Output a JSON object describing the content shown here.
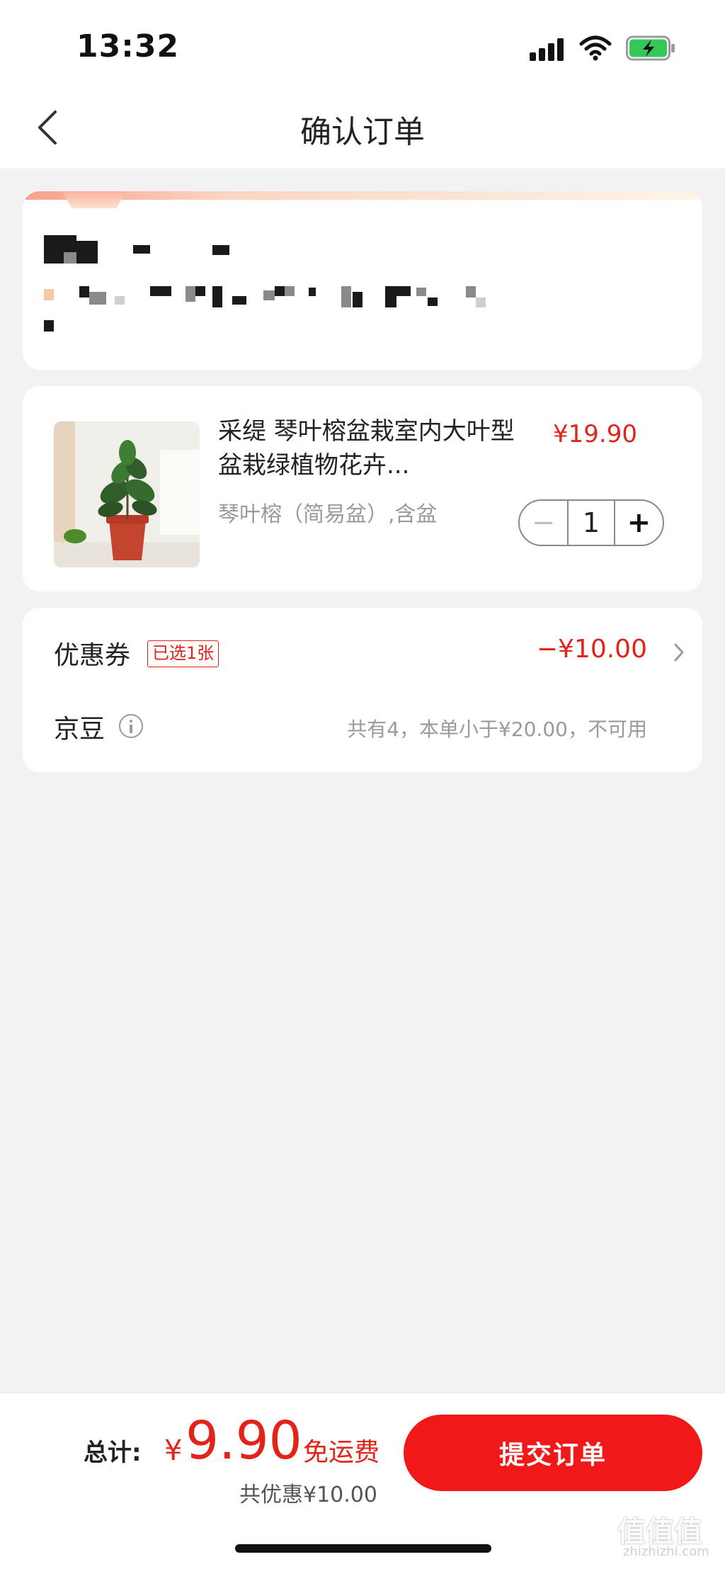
{
  "status_bar": {
    "time": "13:32"
  },
  "nav": {
    "title": "确认订单"
  },
  "product": {
    "title": "采缇 琴叶榕盆栽室内大叶型盆栽绿植物花卉...",
    "spec": "琴叶榕（简易盆）,含盆",
    "price": "¥19.90",
    "quantity": "1",
    "minus_symbol": "−",
    "plus_symbol": "+"
  },
  "discounts": {
    "coupon_label": "优惠券",
    "coupon_badge": "已选1张",
    "coupon_value": "−¥10.00",
    "bean_label": "京豆",
    "bean_note": "共有4，本单小于¥20.00，不可用"
  },
  "bottom": {
    "total_label": "总计:",
    "currency": "¥",
    "total_amount": "9.90",
    "free_shipping": "免运费",
    "saved": "共优惠¥10.00",
    "submit_label": "提交订单"
  },
  "watermark": {
    "text": "值值值",
    "url": "zhizhizhi.com"
  },
  "colors": {
    "accent": "#e2231a",
    "button": "#f01818",
    "background": "#f2f2f2"
  },
  "icons": [
    "back-arrow-icon",
    "signal-icon",
    "wifi-icon",
    "battery-charging-icon",
    "info-icon",
    "chevron-right-icon"
  ]
}
